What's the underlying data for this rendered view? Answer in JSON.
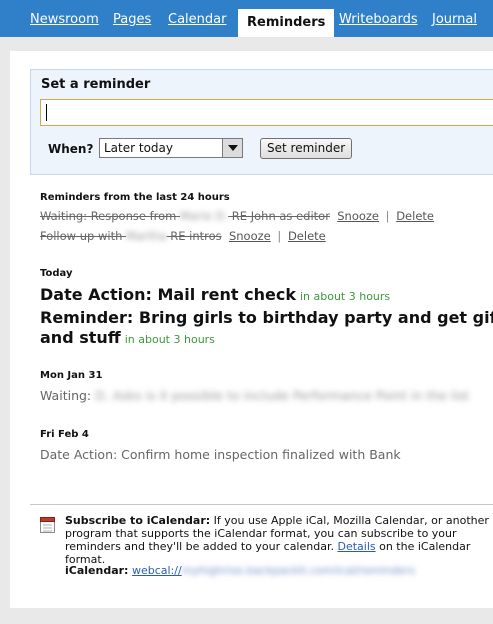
{
  "nav": {
    "tabs": [
      {
        "label": "Newsroom"
      },
      {
        "label": "Pages"
      },
      {
        "label": "Calendar"
      },
      {
        "label": "Reminders"
      },
      {
        "label": "Writeboards"
      },
      {
        "label": "Journal"
      }
    ],
    "active": "Reminders"
  },
  "set_reminder": {
    "title": "Set a reminder",
    "input_value": "",
    "when_label": "When?",
    "when_value": "Later today",
    "button_label": "Set reminder"
  },
  "recent": {
    "heading": "Reminders from the last 24 hours",
    "items": [
      {
        "prefix": "Waiting: Response from",
        "blurred": "Marie D.",
        "suffix": " RE John as editor",
        "snooze": "Snooze",
        "delete": "Delete"
      },
      {
        "prefix": "Follow up with",
        "blurred": "Martha",
        "suffix": " RE intros",
        "snooze": "Snooze",
        "delete": "Delete"
      }
    ],
    "separator": "|"
  },
  "today": {
    "heading": "Today",
    "items": [
      {
        "text": "Date Action: Mail rent check",
        "when": "in about 3 hours"
      },
      {
        "text": "Reminder: Bring girls to birthday party and get gift and stuff",
        "when": "in about 3 hours"
      }
    ]
  },
  "mon": {
    "heading": "Mon Jan 31",
    "label": "Waiting:",
    "blurred": "D. Asks is it possible to include Performance Point in the list"
  },
  "fri": {
    "heading": "Fri Feb 4",
    "text": "Date Action: Confirm home inspection finalized with Bank"
  },
  "ical": {
    "title": "Subscribe to iCalendar:",
    "body": " If you use Apple iCal, Mozilla Calendar, or another program that supports the iCalendar format, you can subscribe to your reminders and they'll be added to your calendar. ",
    "details_link": "Details",
    "details_tail": " on the iCalendar format.",
    "label": "iCalendar:",
    "url_prefix": "webcal://",
    "url_blurred": "myhighrise.backpackit.com/ical/reminders"
  },
  "colors": {
    "nav_bg": "#2f7fc9",
    "page_bg": "#e9e9e9",
    "set_box_bg": "#eef4fc",
    "green": "#3a9a3a",
    "link_blue": "#2a5db0"
  }
}
